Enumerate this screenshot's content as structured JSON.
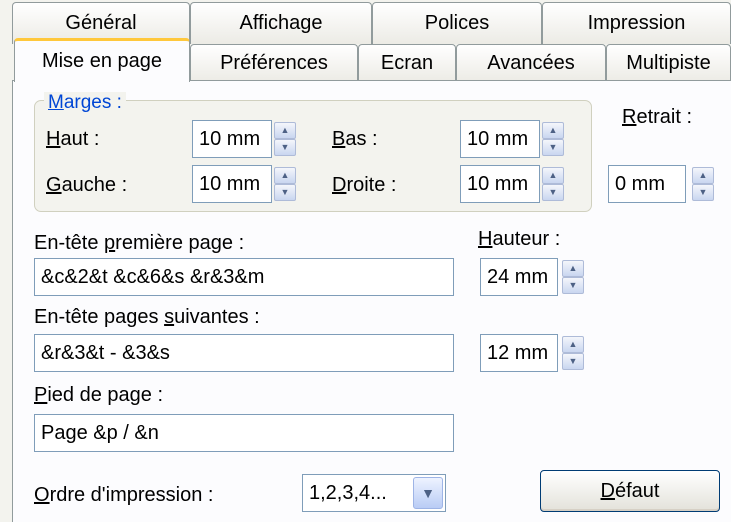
{
  "tabs_row1": [
    "Général",
    "Affichage",
    "Polices",
    "Impression"
  ],
  "tabs_row2": [
    "Mise en page",
    "Préférences",
    "Ecran",
    "Avancées",
    "Multipiste"
  ],
  "active_tab": "Mise en page",
  "margins": {
    "legend": "Marges :",
    "top_label": "Haut :",
    "top_value": "10 mm",
    "bottom_label": "Bas :",
    "bottom_value": "10 mm",
    "left_label": "Gauche :",
    "left_value": "10 mm",
    "right_label": "Droite :",
    "right_value": "10 mm"
  },
  "indent": {
    "label": "Retrait :",
    "value": "0 mm"
  },
  "header_first": {
    "label": "En-tête première page :",
    "value": "&c&2&t &c&6&s &r&3&m"
  },
  "height": {
    "label": "Hauteur :",
    "first_value": "24 mm",
    "next_value": "12 mm"
  },
  "header_next": {
    "label": "En-tête pages suivantes :",
    "value": "&r&3&t - &3&s"
  },
  "footer": {
    "label": "Pied de page :",
    "value": "Page &p / &n"
  },
  "print_order": {
    "label": "Ordre d'impression :",
    "value": "1,2,3,4..."
  },
  "default_button": "Défaut",
  "colors": {
    "accent": "#ffc83c",
    "legend": "#0046d5",
    "border": "#7f9db9"
  }
}
